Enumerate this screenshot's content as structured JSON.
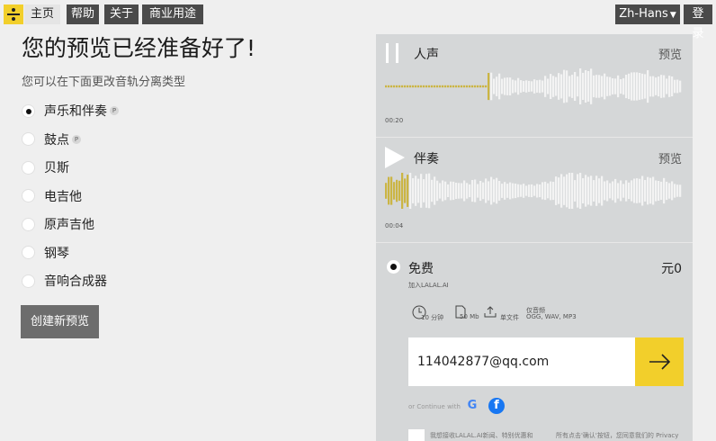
{
  "nav": {
    "home": "主页",
    "help": "帮助",
    "about": "关于",
    "commercial": "商业用途",
    "language": "Zh-Hans",
    "login": "登录"
  },
  "main": {
    "title": "您的预览已经准备好了!",
    "subtitle": "您可以在下面更改音轨分离类型",
    "options": [
      {
        "label": "声乐和伴奏",
        "badge": "P",
        "selected": true
      },
      {
        "label": "鼓点",
        "badge": "P",
        "selected": false
      },
      {
        "label": "贝斯",
        "selected": false
      },
      {
        "label": "电吉他",
        "selected": false
      },
      {
        "label": "原声吉他",
        "selected": false
      },
      {
        "label": "钢琴",
        "selected": false
      },
      {
        "label": "音响合成器",
        "selected": false
      }
    ],
    "create_button": "创建新预览"
  },
  "preview": {
    "tracks": [
      {
        "title": "人声",
        "link": "预览",
        "time": "00:20",
        "progress": 0.35
      },
      {
        "title": "伴奏",
        "link": "预览",
        "time": "00:04",
        "progress": 0.08
      }
    ],
    "plan": {
      "name": "免费",
      "price": "元0",
      "join": "加入LALAL.AI",
      "features": {
        "minutes": "10 分钟",
        "size": "50 Mb",
        "upload": "单文件",
        "formats_label": "仅音频",
        "formats": "OGG, WAV, MP3"
      },
      "email_value": "114042877@qq.com",
      "continue_with": "or Continue with",
      "consent_left": "我想接收LALAL.AI新闻、特别优惠和",
      "consent_right": "所有点击'确认'按钮，您同意我们的 Privacy"
    }
  },
  "colors": {
    "accent": "#f2cf2b",
    "nav_bg": "#4a4a4a",
    "panel_bg": "#d5d7d8",
    "wave_played": "#cbb544",
    "wave_unplayed": "#f3f3f3"
  }
}
